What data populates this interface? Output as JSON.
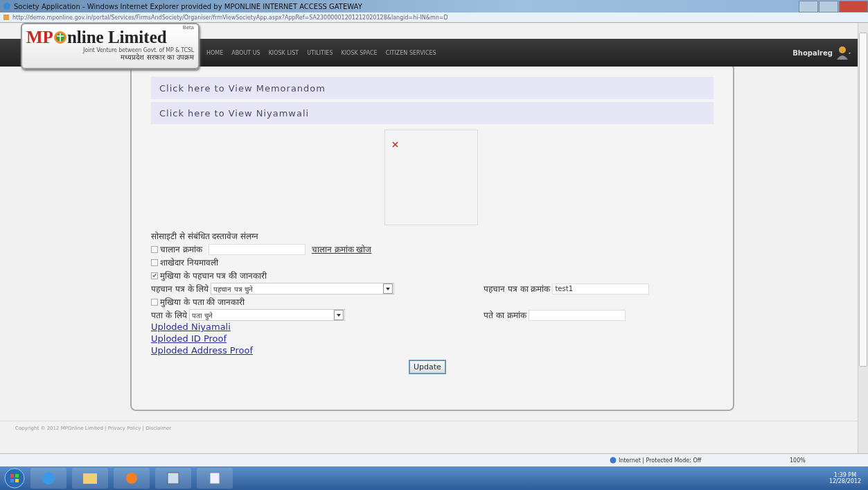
{
  "window": {
    "title": "Society Application - Windows Internet Explorer provided by MPONLINE INTERNET ACCESS GATEWAY"
  },
  "address_bar": {
    "url": "http://demo.mponline.gov.in/portal/Services/FirmsAndSociety/Organiser/frmViewSocietyApp.aspx?AppRef=SA23000001201212020128&langid=hi-IN&mn=D"
  },
  "header": {
    "logo_part_1": "MP",
    "logo_part_2": "nline Limited",
    "beta": "Beta",
    "tagline": "Joint Venture between Govt. of MP & TCSL",
    "tagline_hindi": "मध्यप्रदेश सरकार का उपक्रम",
    "nav": [
      "HOME",
      "ABOUT US",
      "KIOSK LIST",
      "UTILITIES",
      "KIOSK SPACE",
      "CITIZEN SERVICES"
    ],
    "user": "Bhopalreg"
  },
  "panels": [
    {
      "label": "Click here to View Memorandom"
    },
    {
      "label": "Click here to View Niyamwali"
    }
  ],
  "form": {
    "heading": "सोसाइटी से संबंधित दस्तावेज संलग्न",
    "challan": {
      "label": "चालान क्रमांक",
      "checked": false,
      "link": "चालान क्रमांक खोज"
    },
    "niyamavali": {
      "label": "शाखेदार नियमावली",
      "checked": false
    },
    "id_proof": {
      "label": "मुखिया के पहचान पत्र की जानकारी",
      "checked": true,
      "select_label": "पहचान पत्र के लिये",
      "select_value": "पहचान पत्र चुने",
      "number_label": "पहचान पत्र का क्रमांक",
      "number_value": "test1"
    },
    "address_proof": {
      "label": "मुखिया के पता की जानकारी",
      "checked": false,
      "select_label": "पता के लिये",
      "select_value": "पता चुने",
      "number_label": "पते का क्रमांक"
    },
    "links": [
      "Uploded Niyamali",
      "Uploded ID Proof",
      "Uploded Address Proof"
    ],
    "update_button": "Update"
  },
  "footer": {
    "text": "Copyright © 2012 MPOnline Limited | Privacy Policy | Disclaimer"
  },
  "status_bar": {
    "zone": "Internet | Protected Mode: Off",
    "zoom": "100%"
  },
  "taskbar": {
    "time": "1:39 PM",
    "date": "12/28/2012"
  }
}
